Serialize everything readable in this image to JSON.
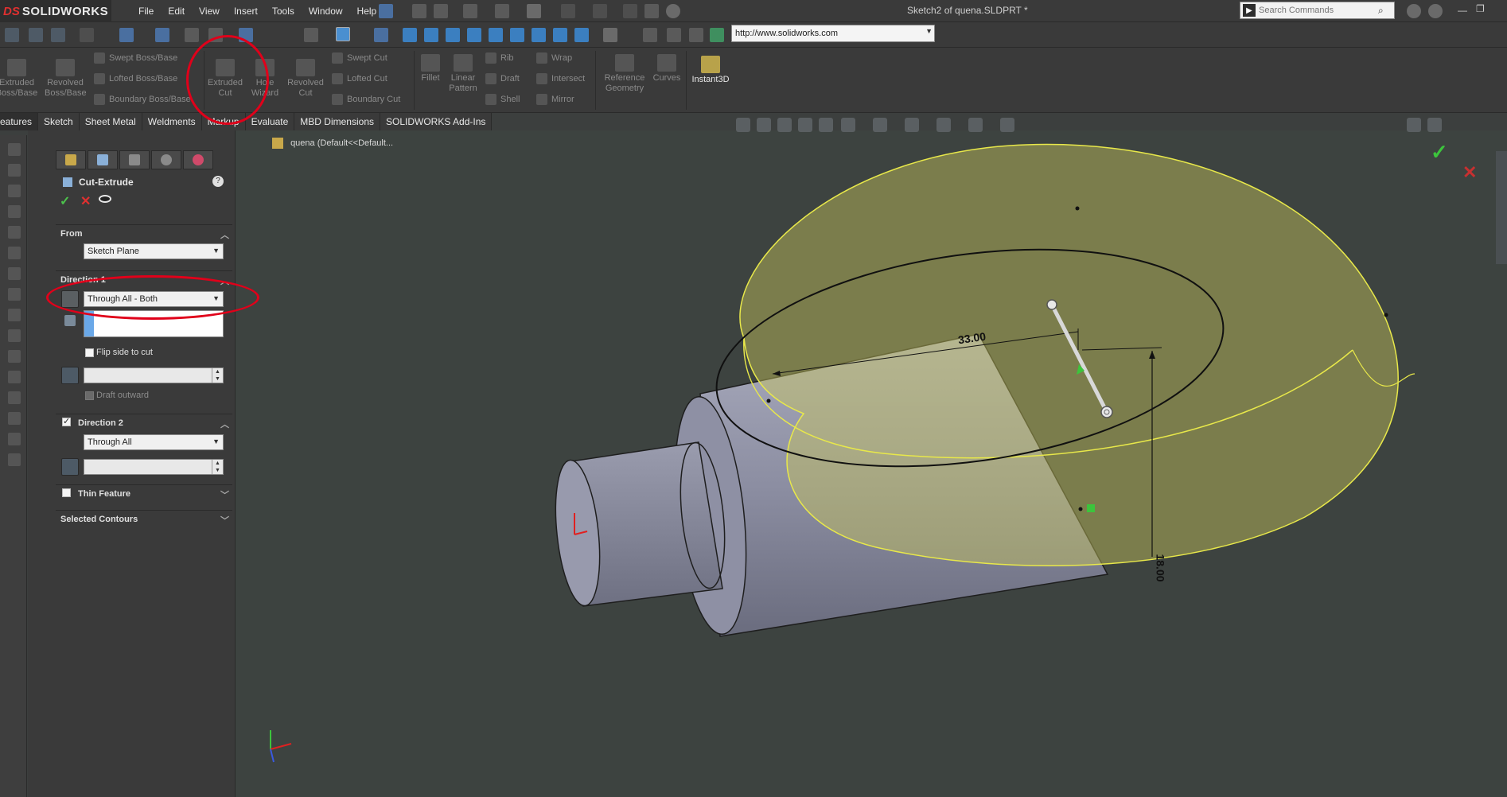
{
  "app": {
    "brand_prefix": "DS",
    "brand_name": "SOLIDWORKS",
    "document_title": "Sketch2 of quena.SLDPRT *"
  },
  "menu": [
    "File",
    "Edit",
    "View",
    "Insert",
    "Tools",
    "Window",
    "Help"
  ],
  "search": {
    "placeholder": "Search Commands"
  },
  "address_bar": {
    "value": "http://www.solidworks.com"
  },
  "ribbon": {
    "extruded_boss": "Extruded Boss/Base",
    "revolved_boss": "Revolved Boss/Base",
    "swept_boss": "Swept Boss/Base",
    "lofted_boss": "Lofted Boss/Base",
    "boundary_boss": "Boundary Boss/Base",
    "extruded_cut": "Extruded Cut",
    "hole_wizard": "Hole Wizard",
    "revolved_cut": "Revolved Cut",
    "swept_cut": "Swept Cut",
    "lofted_cut": "Lofted Cut",
    "boundary_cut": "Boundary Cut",
    "fillet": "Fillet",
    "linear_pattern": "Linear Pattern",
    "rib": "Rib",
    "draft": "Draft",
    "shell": "Shell",
    "wrap": "Wrap",
    "intersect": "Intersect",
    "mirror": "Mirror",
    "reference_geometry": "Reference Geometry",
    "curves": "Curves",
    "instant3d": "Instant3D"
  },
  "tabs": [
    "eatures",
    "Sketch",
    "Sheet Metal",
    "Weldments",
    "Markup",
    "Evaluate",
    "MBD Dimensions",
    "SOLIDWORKS Add-Ins"
  ],
  "property_manager": {
    "title": "Cut-Extrude",
    "from_header": "From",
    "from_value": "Sketch Plane",
    "direction1_header": "Direction 1",
    "direction1_value": "Through All - Both",
    "flip_side_label": "Flip side to cut",
    "draft_outward_label": "Draft outward",
    "direction2_header": "Direction 2",
    "direction2_value": "Through All",
    "thin_feature_header": "Thin Feature",
    "selected_contours_header": "Selected Contours"
  },
  "feature_tree": {
    "root_label": "quena  (Default<<Default..."
  },
  "dimensions": {
    "horizontal": "33.00",
    "vertical": "18.00"
  },
  "colors": {
    "annotation": "#e0001a",
    "preview": "#c8c65a",
    "part": "#8a8c9e",
    "background": "#3d4340"
  }
}
